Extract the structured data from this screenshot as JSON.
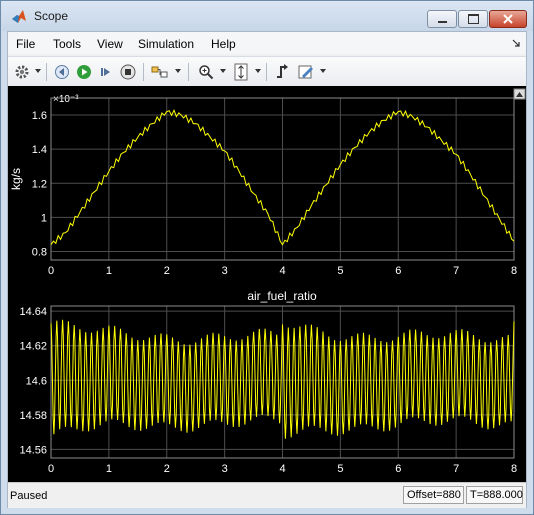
{
  "window": {
    "title": "Scope",
    "app_icon": "matlab-logo-icon"
  },
  "menu": [
    "File",
    "Tools",
    "View",
    "Simulation",
    "Help"
  ],
  "toolbar": {
    "icons": [
      "gear-icon",
      "step-back-icon",
      "run-icon",
      "step-forward-icon",
      "stop-icon",
      "highlight-block-icon",
      "zoom-icon",
      "scale-axes-icon",
      "triggers-icon",
      "style-icon"
    ]
  },
  "colors": {
    "trace": "#ffff00",
    "axes_bg": "#000000",
    "grid": "#4d4d4d",
    "tick_text": "#ffffff"
  },
  "chart_data": [
    {
      "type": "line",
      "title": "",
      "ylabel": "kg/s",
      "y_exponent_label": "×10⁻³",
      "xlim": [
        0,
        8
      ],
      "ylim": [
        0.75,
        1.7
      ],
      "xticks": [
        0,
        1,
        2,
        3,
        4,
        5,
        6,
        7,
        8
      ],
      "yticks": [
        "0.8",
        "1",
        "1.2",
        "1.4",
        "1.6"
      ],
      "grid": true,
      "series": [
        {
          "x": [
            0,
            0.25,
            0.5,
            0.75,
            1.0,
            1.25,
            1.5,
            1.75,
            2.0,
            2.25,
            2.5,
            2.75,
            3.0,
            3.25,
            3.5,
            3.75,
            4.0,
            4.25,
            4.5,
            4.75,
            5.0,
            5.25,
            5.5,
            5.75,
            6.0,
            6.25,
            6.5,
            6.75,
            7.0,
            7.25,
            7.5,
            7.75,
            8.0
          ],
          "y": [
            0.84,
            0.91,
            1.03,
            1.15,
            1.27,
            1.38,
            1.47,
            1.55,
            1.62,
            1.6,
            1.55,
            1.47,
            1.39,
            1.27,
            1.14,
            1.02,
            0.84,
            0.94,
            1.07,
            1.19,
            1.31,
            1.41,
            1.5,
            1.57,
            1.62,
            1.59,
            1.53,
            1.45,
            1.37,
            1.25,
            1.12,
            0.99,
            0.86
          ]
        }
      ]
    },
    {
      "type": "line",
      "title": "air_fuel_ratio",
      "ylabel": "",
      "xlim": [
        0,
        8
      ],
      "ylim": [
        14.555,
        14.643
      ],
      "xticks": [
        0,
        1,
        2,
        3,
        4,
        5,
        6,
        7,
        8
      ],
      "yticks": [
        "14.56",
        "14.58",
        "14.6",
        "14.62",
        "14.64"
      ],
      "grid": true,
      "series": [
        {
          "mean": 14.6,
          "oscillation_period": 0.1,
          "amplitude_start": 0.033,
          "amplitude_min": 0.025,
          "restart_at_x": 4.0,
          "x": [
            0,
            1,
            2,
            3,
            4,
            5,
            6,
            7,
            8
          ],
          "y_envelope_max": [
            14.636,
            14.624,
            14.622,
            14.621,
            14.637,
            14.626,
            14.622,
            14.621,
            14.62
          ],
          "y_envelope_min": [
            14.564,
            14.576,
            14.578,
            14.571,
            14.565,
            14.576,
            14.577,
            14.571,
            14.567
          ]
        }
      ]
    }
  ],
  "status": {
    "state": "Paused",
    "offset": "Offset=880",
    "time": "T=888.000"
  }
}
